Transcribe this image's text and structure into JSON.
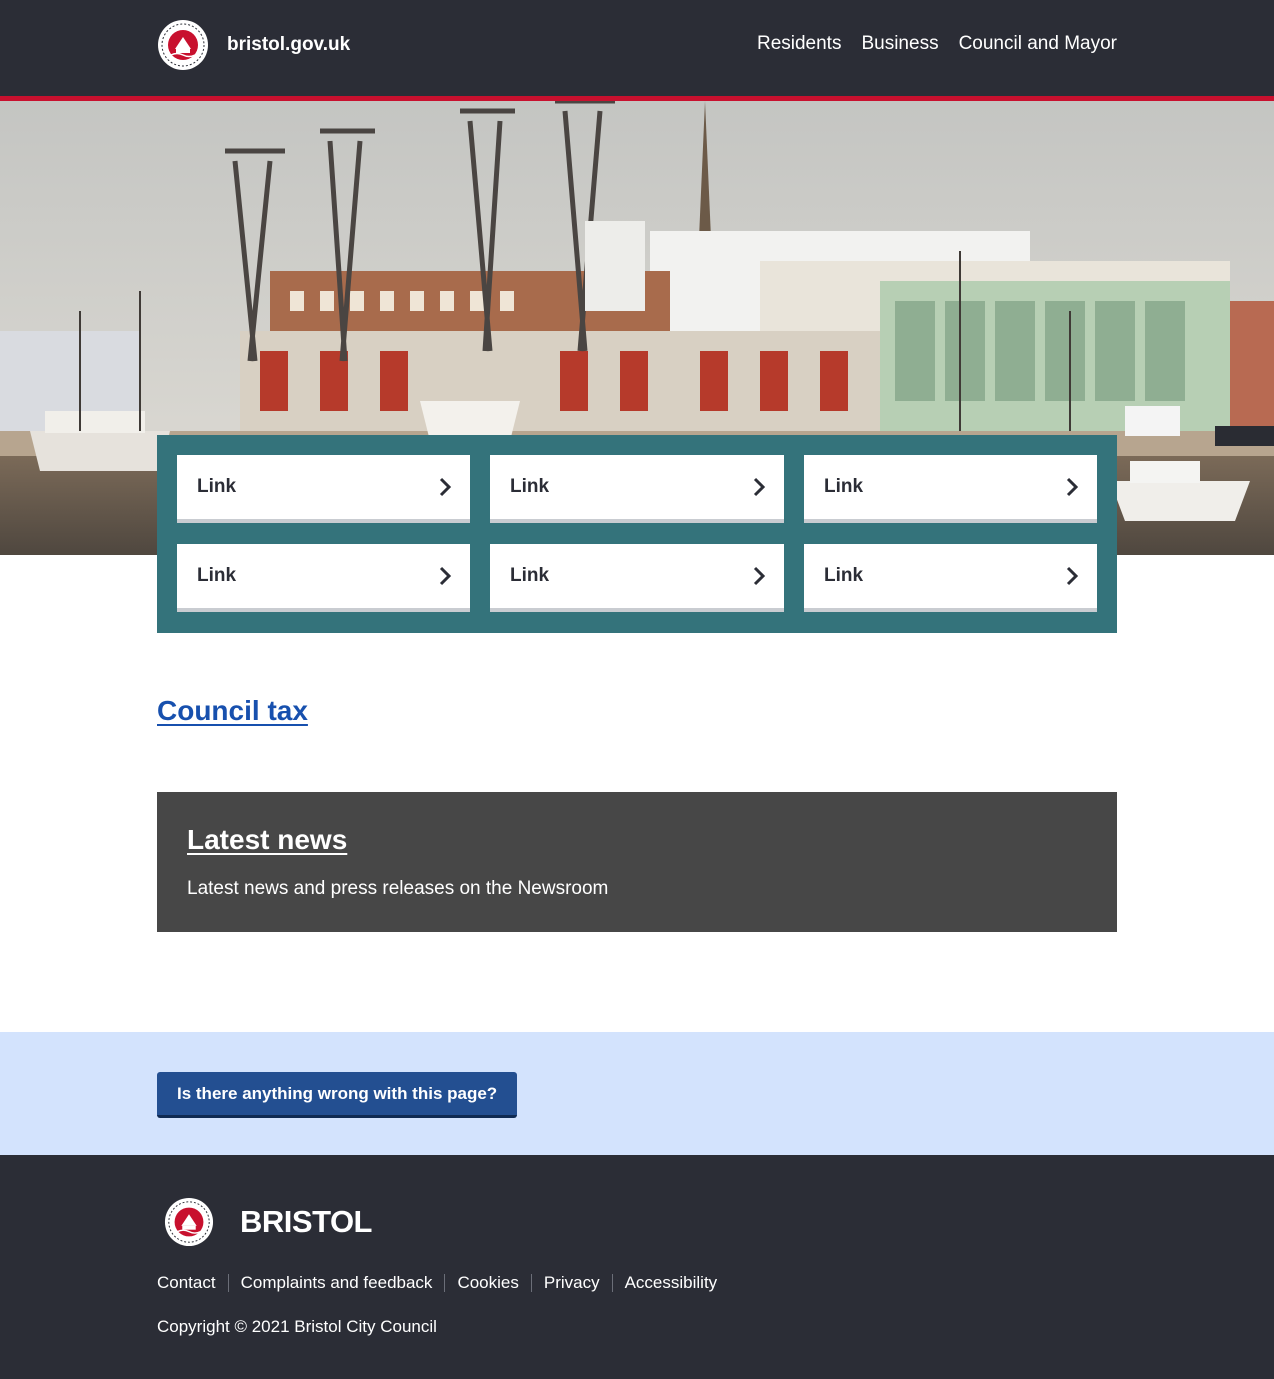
{
  "header": {
    "site_name": "bristol.gov.uk",
    "nav": [
      "Residents",
      "Business",
      "Council and Mayor"
    ]
  },
  "hero": {
    "image": "harbourside-cranes-photo"
  },
  "quick_links": [
    "Link",
    "Link",
    "Link",
    "Link",
    "Link",
    "Link"
  ],
  "council_tax": {
    "label": "Council tax"
  },
  "news": {
    "title": "Latest news",
    "description": "Latest news and press releases on the Newsroom"
  },
  "feedback": {
    "button_label": "Is there anything wrong with this page?"
  },
  "footer": {
    "wordmark": "BRISTOL",
    "links": [
      "Contact",
      "Complaints and feedback",
      "Cookies",
      "Privacy",
      "Accessibility"
    ],
    "copyright": "Copyright © 2021 Bristol City Council"
  },
  "colors": {
    "header_bg": "#2b2d36",
    "accent_red": "#c8102e",
    "panel_teal": "#34737b",
    "link_blue": "#1750ae",
    "news_bg": "#474747",
    "feedback_bg": "#d3e3fd",
    "button_blue": "#234f91"
  }
}
